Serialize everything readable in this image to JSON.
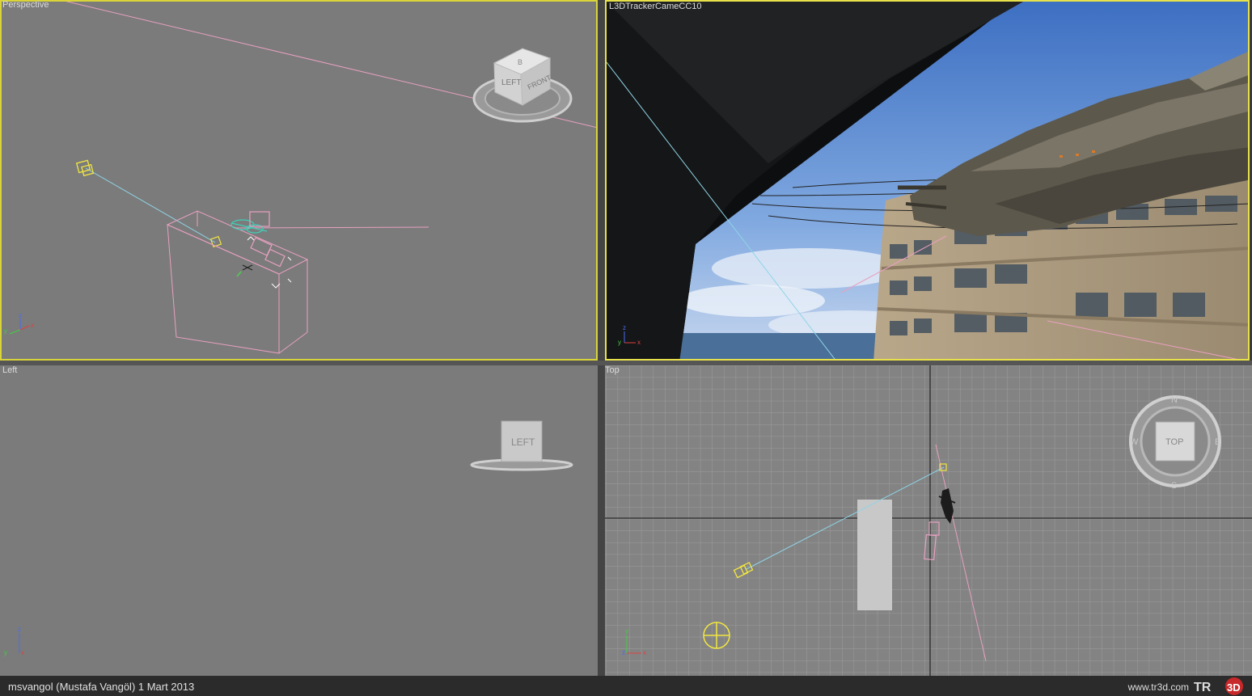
{
  "viewports": {
    "perspective": {
      "label": "Perspective",
      "viewcube": {
        "left": "LEFT",
        "front": "FRONT",
        "top": "B"
      }
    },
    "camera": {
      "label": "L3DTrackerCameCC10"
    },
    "left": {
      "label": "Left",
      "viewcube": {
        "face": "LEFT"
      }
    },
    "top": {
      "label": "Top",
      "viewcube": {
        "face": "TOP",
        "north": "N",
        "south": "S",
        "east": "E",
        "west": "W"
      }
    }
  },
  "axis_tripod": {
    "x": "x",
    "y": "y",
    "z": "z"
  },
  "status_bar": {
    "credit": "msvangol (Mustafa Vangöl)  1 Mart 2013",
    "site": "www.tr3d.com",
    "logo": "TR3D"
  },
  "colors": {
    "viewport_bg": "#7b7b7b",
    "active_border": "#e8e24a",
    "camera_line": "#8fd4e6",
    "pink_object": "#e8a0c0",
    "yellow_object": "#f2e640",
    "teal_object": "#3fd0b8",
    "grid": "#9a9a9a"
  }
}
